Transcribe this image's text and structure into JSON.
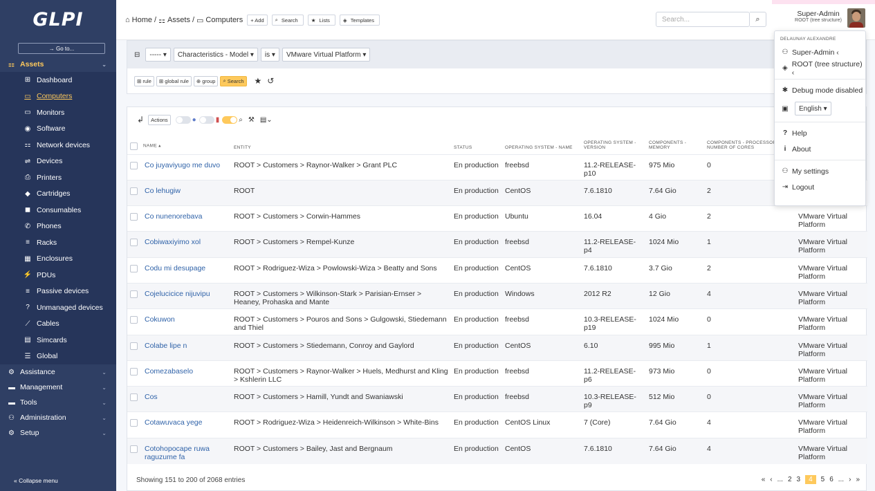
{
  "app": {
    "logo": "GLPI"
  },
  "sidebar": {
    "goto": "→ Go to...",
    "assets_label": "Assets",
    "items": [
      {
        "label": "Dashboard",
        "icon": "⊞"
      },
      {
        "label": "Computers",
        "icon": "▭"
      },
      {
        "label": "Monitors",
        "icon": "▭"
      },
      {
        "label": "Software",
        "icon": "◉"
      },
      {
        "label": "Network devices",
        "icon": "⚏"
      },
      {
        "label": "Devices",
        "icon": "⇌"
      },
      {
        "label": "Printers",
        "icon": "⎙"
      },
      {
        "label": "Cartridges",
        "icon": "◆"
      },
      {
        "label": "Consumables",
        "icon": "◼"
      },
      {
        "label": "Phones",
        "icon": "✆"
      },
      {
        "label": "Racks",
        "icon": "≡"
      },
      {
        "label": "Enclosures",
        "icon": "▦"
      },
      {
        "label": "PDUs",
        "icon": "⚡"
      },
      {
        "label": "Passive devices",
        "icon": "≡"
      },
      {
        "label": "Unmanaged devices",
        "icon": "?"
      },
      {
        "label": "Cables",
        "icon": "⟋"
      },
      {
        "label": "Simcards",
        "icon": "▤"
      },
      {
        "label": "Global",
        "icon": "☰"
      }
    ],
    "sections": [
      {
        "label": "Assistance",
        "icon": "⚙"
      },
      {
        "label": "Management",
        "icon": "▬"
      },
      {
        "label": "Tools",
        "icon": "▬"
      },
      {
        "label": "Administration",
        "icon": "⚇"
      },
      {
        "label": "Setup",
        "icon": "⚙"
      }
    ],
    "collapse": "« Collapse menu"
  },
  "header": {
    "breadcrumb": [
      "Home",
      "Assets",
      "Computers"
    ],
    "buttons": [
      "+ Add",
      "Search",
      "Lists",
      "Templates"
    ],
    "search_placeholder": "Search...",
    "user_name": "Super-Admin",
    "user_entity": "ROOT (tree structure)"
  },
  "criteria": {
    "link": "----- ▾",
    "field": "Characteristics - Model ▾",
    "operator": "is ▾",
    "value": "VMware Virtual Platform ▾",
    "btn_rule": "rule",
    "btn_global_rule": "global rule",
    "btn_group": "group",
    "btn_search": "Search"
  },
  "toolbar": {
    "actions": "Actions"
  },
  "columns": [
    "Name",
    "Entity",
    "Status",
    "Operating system - Name",
    "Operating system - Version",
    "Components - Memory",
    "Components - Processor number of cores",
    ""
  ],
  "rows": [
    [
      "Co juyaviyugo me duvo",
      "ROOT > Customers > Raynor-Walker > Grant PLC",
      "En production",
      "freebsd",
      "11.2-RELEASE-p10",
      "975 Mio",
      "0",
      ""
    ],
    [
      "Co lehugiw",
      "ROOT",
      "En production",
      "CentOS",
      "7.6.1810",
      "7.64 Gio",
      "2",
      ""
    ],
    [
      "Co nunenorebava",
      "ROOT > Customers > Corwin-Hammes",
      "En production",
      "Ubuntu",
      "16.04",
      "4 Gio",
      "2",
      "VMware Virtual Platform"
    ],
    [
      "Cobiwaxiyimo xol",
      "ROOT > Customers > Rempel-Kunze",
      "En production",
      "freebsd",
      "11.2-RELEASE-p4",
      "1024 Mio",
      "1",
      "VMware Virtual Platform"
    ],
    [
      "Codu mi desupage",
      "ROOT > Rodriguez-Wiza > Powlowski-Wiza > Beatty and Sons",
      "En production",
      "CentOS",
      "7.6.1810",
      "3.7 Gio",
      "2",
      "VMware Virtual Platform"
    ],
    [
      "Cojelucicice nijuvipu",
      "ROOT > Customers > Wilkinson-Stark > Parisian-Ernser > Heaney, Prohaska and Mante",
      "En production",
      "Windows",
      "2012 R2",
      "12 Gio",
      "4",
      "VMware Virtual Platform"
    ],
    [
      "Cokuwon",
      "ROOT > Customers > Pouros and Sons > Gulgowski, Stiedemann and Thiel",
      "En production",
      "freebsd",
      "10.3-RELEASE-p19",
      "1024 Mio",
      "0",
      "VMware Virtual Platform"
    ],
    [
      "Colabe lipe n",
      "ROOT > Customers > Stiedemann, Conroy and Gaylord",
      "En production",
      "CentOS",
      "6.10",
      "995 Mio",
      "1",
      "VMware Virtual Platform"
    ],
    [
      "Comezabaselo",
      "ROOT > Customers > Raynor-Walker > Huels, Medhurst and Kling > Kshlerin LLC",
      "En production",
      "freebsd",
      "11.2-RELEASE-p6",
      "973 Mio",
      "0",
      "VMware Virtual Platform"
    ],
    [
      "Cos",
      "ROOT > Customers > Hamill, Yundt and Swaniawski",
      "En production",
      "freebsd",
      "10.3-RELEASE-p9",
      "512 Mio",
      "0",
      "VMware Virtual Platform"
    ],
    [
      "Cotawuvaca yege",
      "ROOT > Rodriguez-Wiza > Heidenreich-Wilkinson > White-Bins",
      "En production",
      "CentOS Linux",
      "7 (Core)",
      "7.64 Gio",
      "4",
      "VMware Virtual Platform"
    ],
    [
      "Cotohopocape ruwa raguzume fa",
      "ROOT > Customers > Bailey, Jast and Bergnaum",
      "En production",
      "CentOS",
      "7.6.1810",
      "7.64 Gio",
      "4",
      "VMware Virtual Platform"
    ]
  ],
  "footer": {
    "showing": "Showing 151 to 200 of 2068 entries",
    "pages": [
      "«",
      "‹",
      "...",
      "2",
      "3",
      "4",
      "5",
      "6",
      "...",
      "›",
      "»"
    ],
    "current_page": "4"
  },
  "user_menu": {
    "header": "DELAUNAY ALEXANDRE",
    "items": [
      {
        "label": "Super-Admin ‹",
        "icon": "⚇"
      },
      {
        "label": "ROOT (tree structure) ‹",
        "icon": "◈"
      },
      {
        "label": "Debug mode disabled",
        "icon": "✱"
      },
      {
        "label": "English ▾",
        "icon": "▣"
      },
      {
        "label": "Help",
        "icon": "?"
      },
      {
        "label": "About",
        "icon": "i"
      },
      {
        "label": "My settings",
        "icon": "⚇"
      },
      {
        "label": "Logout",
        "icon": "⇥"
      }
    ]
  }
}
